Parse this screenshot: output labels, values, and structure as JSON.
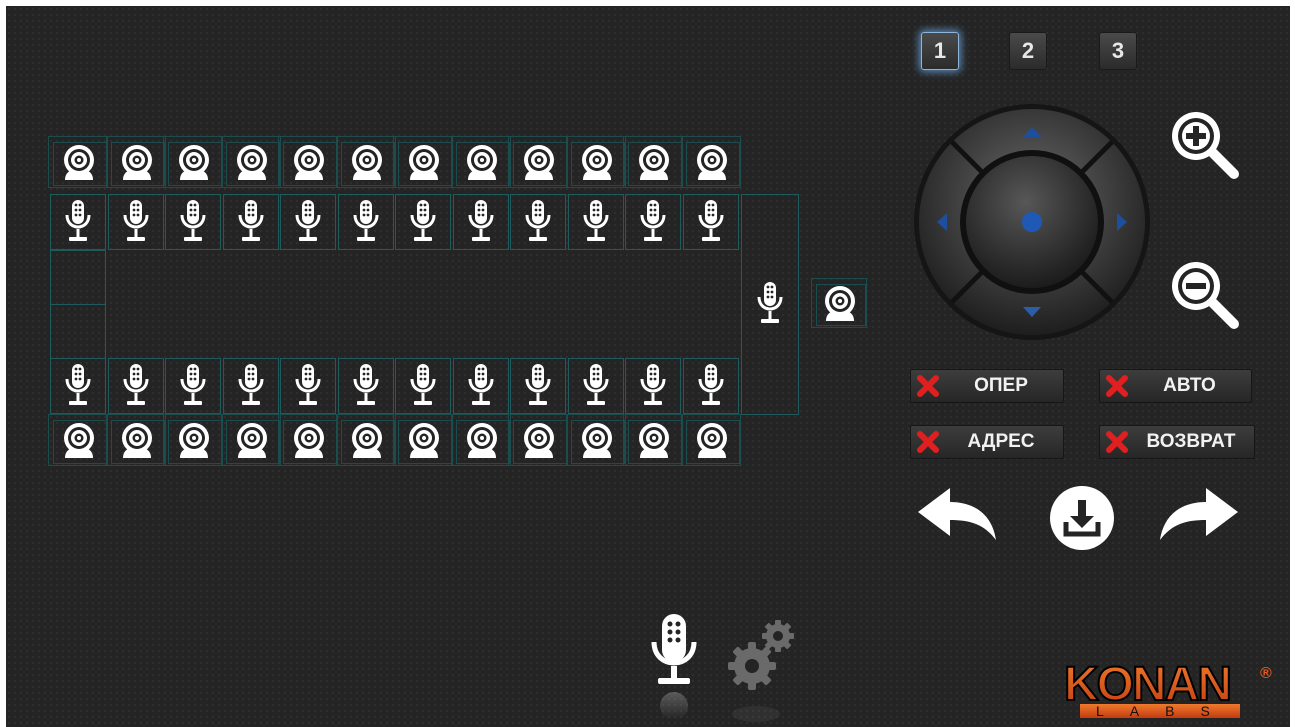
{
  "pages": [
    "1",
    "2",
    "3"
  ],
  "active_page": "1",
  "seats": {
    "top_cameras": 12,
    "top_mics": 12,
    "bottom_mics": 12,
    "bottom_cameras": 12,
    "side_mic": 1,
    "side_camera": 1
  },
  "presets": {
    "oper": "ОПЕР",
    "avto": "АВТО",
    "adres": "АДРЕС",
    "vozvrat": "ВОЗВРАТ"
  },
  "logo": {
    "brand": "KONAN",
    "sub": "LABS",
    "reg": "®"
  },
  "colors": {
    "background": "#242424",
    "cell_border": "#1f5a5c",
    "accent_blue": "#2b5da8",
    "logo_orange": "#e25a1c",
    "x_red": "#e02020"
  }
}
